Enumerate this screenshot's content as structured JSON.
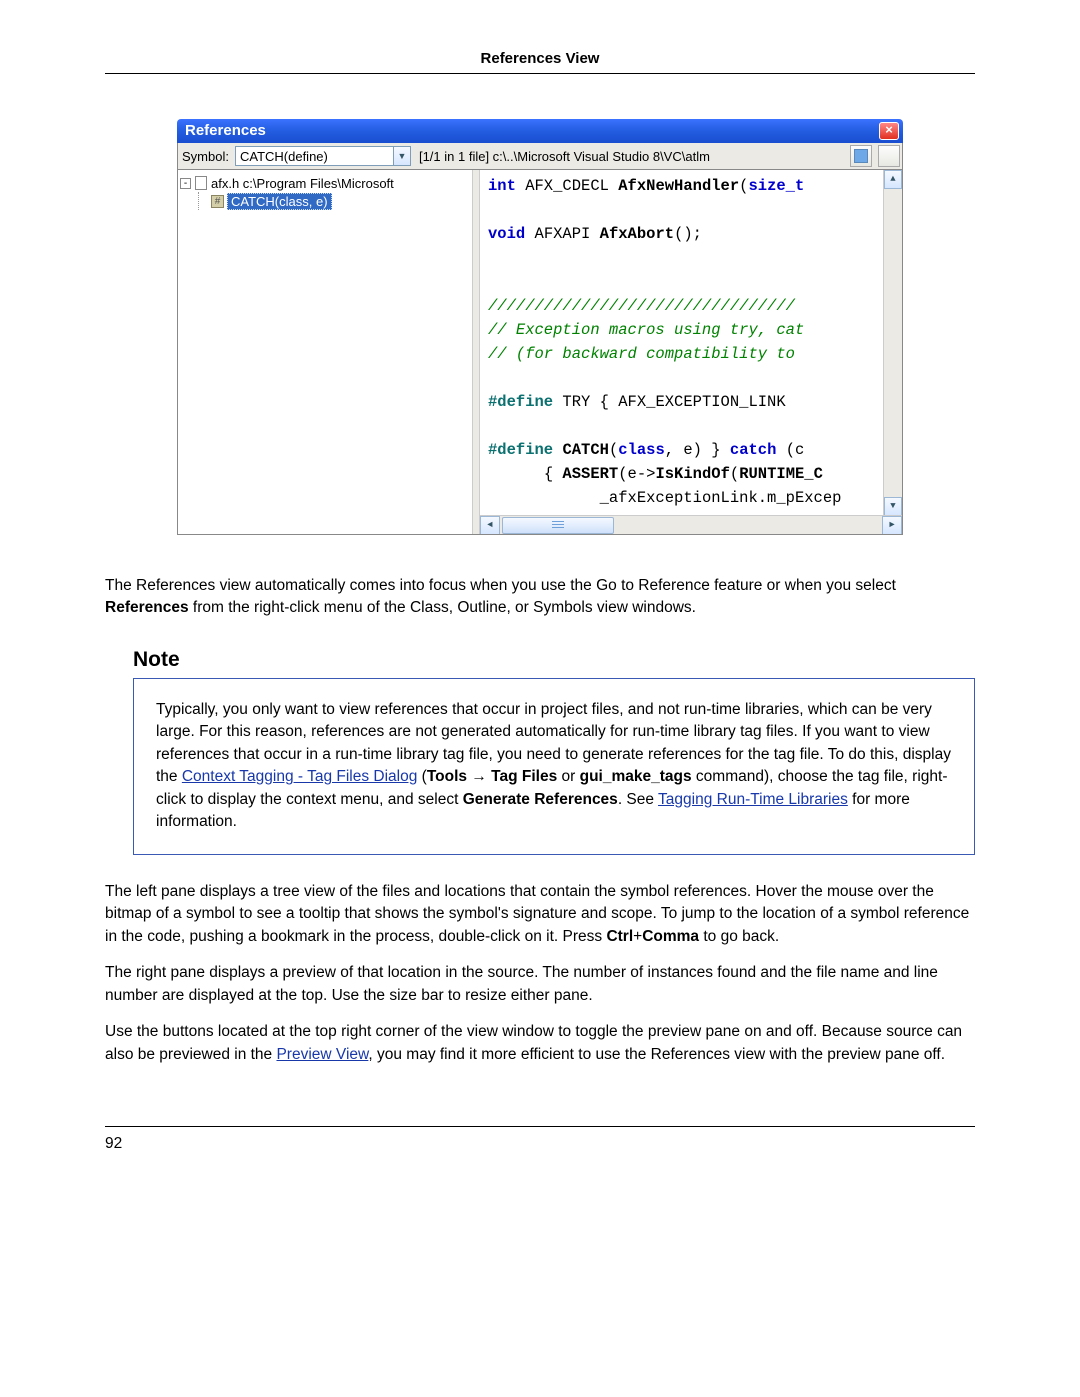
{
  "header": {
    "title": "References View"
  },
  "window": {
    "title": "References",
    "symbol_label": "Symbol:",
    "symbol_value": "CATCH(define)",
    "status": "[1/1 in 1 file] c:\\..\\Microsoft Visual Studio 8\\VC\\atlm"
  },
  "tree": {
    "file_label": "afx.h   c:\\Program Files\\Microsoft",
    "child_label": "CATCH(class, e)"
  },
  "code": {
    "l1a": "int",
    "l1b": " AFX_CDECL ",
    "l1c": "AfxNewHandler",
    "l1d": "(",
    "l1e": "size_t",
    "l3a": "void",
    "l3b": " AFXAPI ",
    "l3c": "AfxAbort",
    "l3d": "();",
    "c1": "/////////////////////////////////",
    "c2": "// Exception macros using try, cat",
    "c3": "//  (for backward compatibility to",
    "d1a": "#define",
    "d1b": " TRY { AFX_EXCEPTION_LINK ",
    "d2a": "#define",
    "d2b": " ",
    "d2c": "CATCH",
    "d2d": "(",
    "d2e": "class",
    "d2f": ", e) } ",
    "d2g": "catch",
    "d2h": " (c",
    "d3": "{ ",
    "d3b": "ASSERT",
    "d3c": "(e->",
    "d3d": "IsKindOf",
    "d3e": "(",
    "d3f": "RUNTIME_C",
    "d4": "_afxExceptionLink.m_pExcep"
  },
  "body": {
    "p1a": "The References view automatically comes into focus when you use the Go to Reference feature or when you select ",
    "p1b": "References",
    "p1c": " from the right-click menu of the Class, Outline, or Symbols view windows.",
    "note_title": "Note",
    "note1": "Typically, you only want to view references that occur in project files, and not run-time libraries, which can be very large. For this reason, references are not generated automatically for run-time library tag files. If you want to view references that occur in a run-time library tag file, you need to generate references for the tag file. To do this, display the ",
    "note_link1": "Context Tagging - Tag Files Dialog",
    "note2a": " (",
    "note2b": "Tools",
    "note2arrow": " → ",
    "note2c": "Tag Files",
    "note2d": " or ",
    "note2e": "gui_make_tags",
    "note2f": " command), choose the tag file, right-click to display the context menu, and select ",
    "note2g": "Generate References",
    "note2h": ". See ",
    "note_link2": "Tagging Run-Time Libraries",
    "note2i": " for more information.",
    "p2a": "The left pane displays a tree view of the files and locations that contain the symbol references. Hover the mouse over the bitmap of a symbol to see a tooltip that shows the symbol's signature and scope. To jump to the location of a symbol reference in the code, pushing a bookmark in the process, double-click on it. Press ",
    "p2b": "Ctrl",
    "p2c": "+",
    "p2d": "Comma",
    "p2e": " to go back.",
    "p3": "The right pane displays a preview of that location in the source. The number of instances found and the file name and line number are displayed at the top. Use the size bar to resize either pane.",
    "p4a": "Use the buttons located at the top right corner of the view window to toggle the preview pane on and off. Because source can also be previewed in the ",
    "p4link": "Preview View",
    "p4b": ", you may find it more efficient to use the References view with the preview pane off."
  },
  "footer": {
    "page": "92"
  }
}
